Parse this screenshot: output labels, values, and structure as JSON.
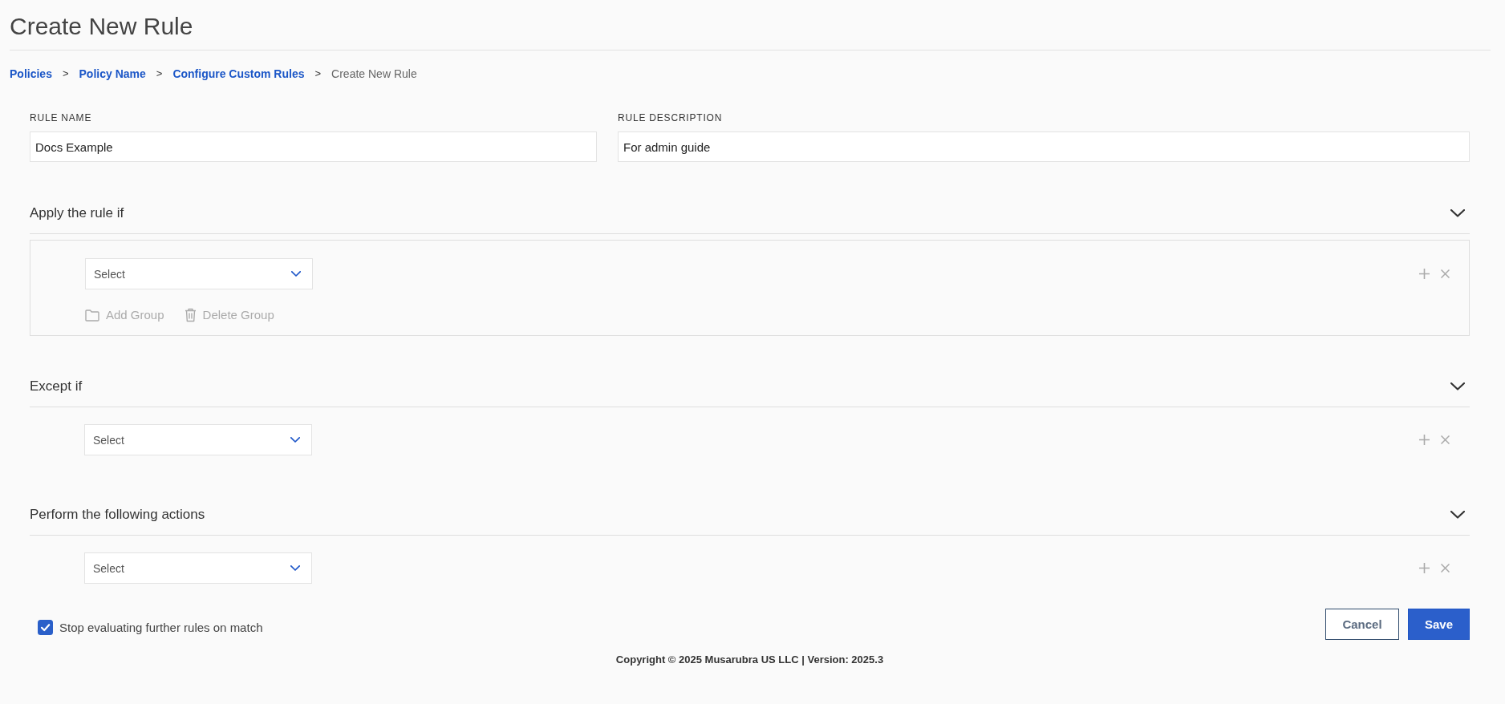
{
  "page": {
    "title": "Create New Rule"
  },
  "breadcrumb": [
    {
      "kind": "link",
      "label": "Policies"
    },
    {
      "kind": "separator",
      "label": ">"
    },
    {
      "kind": "link",
      "label": "Policy Name"
    },
    {
      "kind": "separator",
      "label": ">"
    },
    {
      "kind": "link",
      "label": "Configure Custom Rules"
    },
    {
      "kind": "separator",
      "label": ">"
    },
    {
      "kind": "current",
      "label": "Create New Rule"
    }
  ],
  "fields": [
    {
      "label": "RULE NAME",
      "value": "Docs Example"
    },
    {
      "label": "RULE DESCRIPTION",
      "value": "For admin guide"
    }
  ],
  "sections": [
    {
      "title": "Apply the rule if",
      "expanded": true,
      "conditions": [
        {
          "placeholder": "Select"
        }
      ],
      "group": {
        "actions": [
          {
            "kind": "add",
            "label": "Add Group",
            "disabled": true
          },
          {
            "kind": "delete",
            "label": "Delete Group",
            "disabled": true
          }
        ]
      }
    },
    {
      "title": "Except if",
      "expanded": true,
      "conditions": [
        {
          "placeholder": "Select"
        }
      ]
    },
    {
      "title": "Perform the following actions",
      "expanded": true,
      "conditions": [
        {
          "placeholder": "Select"
        }
      ]
    }
  ],
  "stop_option": {
    "label": "Stop evaluating further rules on match",
    "checked": true
  },
  "buttons": [
    {
      "kind": "secondary",
      "label": "Cancel"
    },
    {
      "kind": "primary",
      "label": "Save"
    }
  ],
  "footer": {
    "text": "Copyright © 2025 Musarubra US LLC | Version: 2025.3"
  }
}
